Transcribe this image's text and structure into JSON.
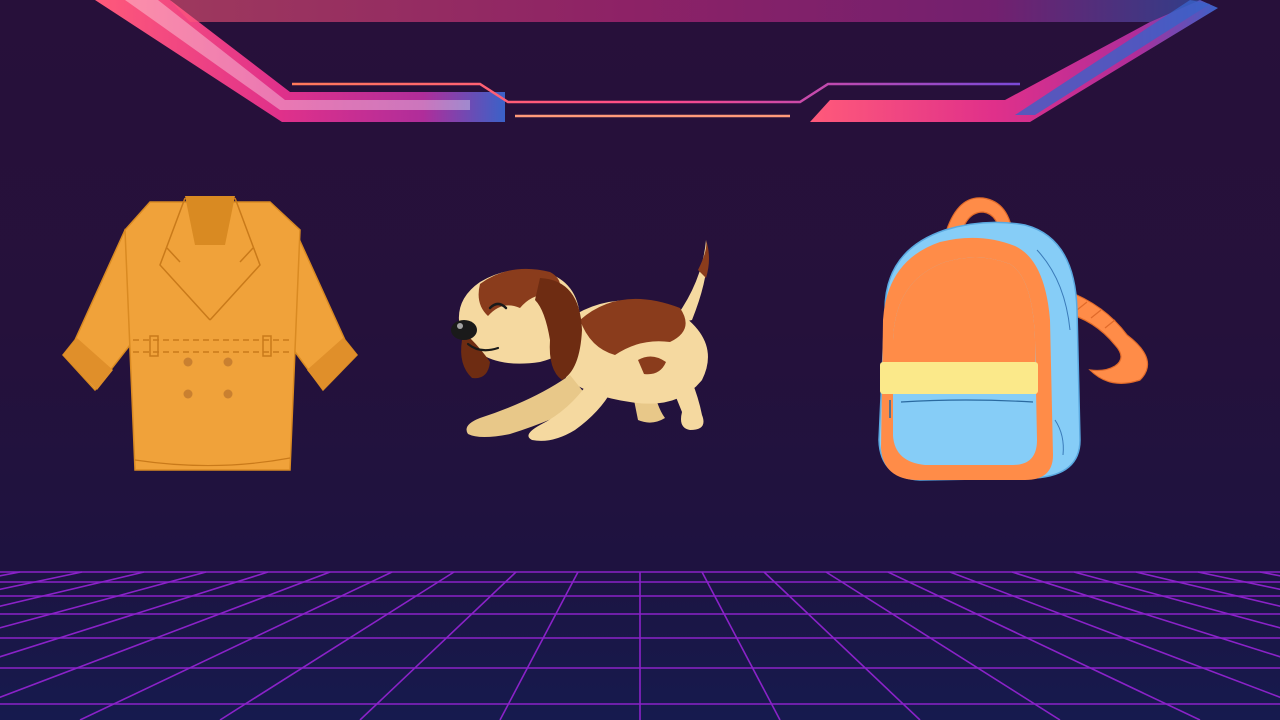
{
  "slide": {
    "background_color": "#25113b",
    "floor_grid_color": "#8a22c8",
    "frame_gradient_colors": [
      "#ff5a7a",
      "#e0308a",
      "#b02d9a",
      "#3a62c8"
    ]
  },
  "items": [
    {
      "icon": "coat-icon",
      "fill_color": "#f0a23a"
    },
    {
      "icon": "dog-icon",
      "fill_color": "#f5d9a0",
      "accent_color": "#8a3c1c"
    },
    {
      "icon": "backpack-icon",
      "fill_color": "#86cdf7",
      "accent_color": "#ff8c48"
    }
  ]
}
